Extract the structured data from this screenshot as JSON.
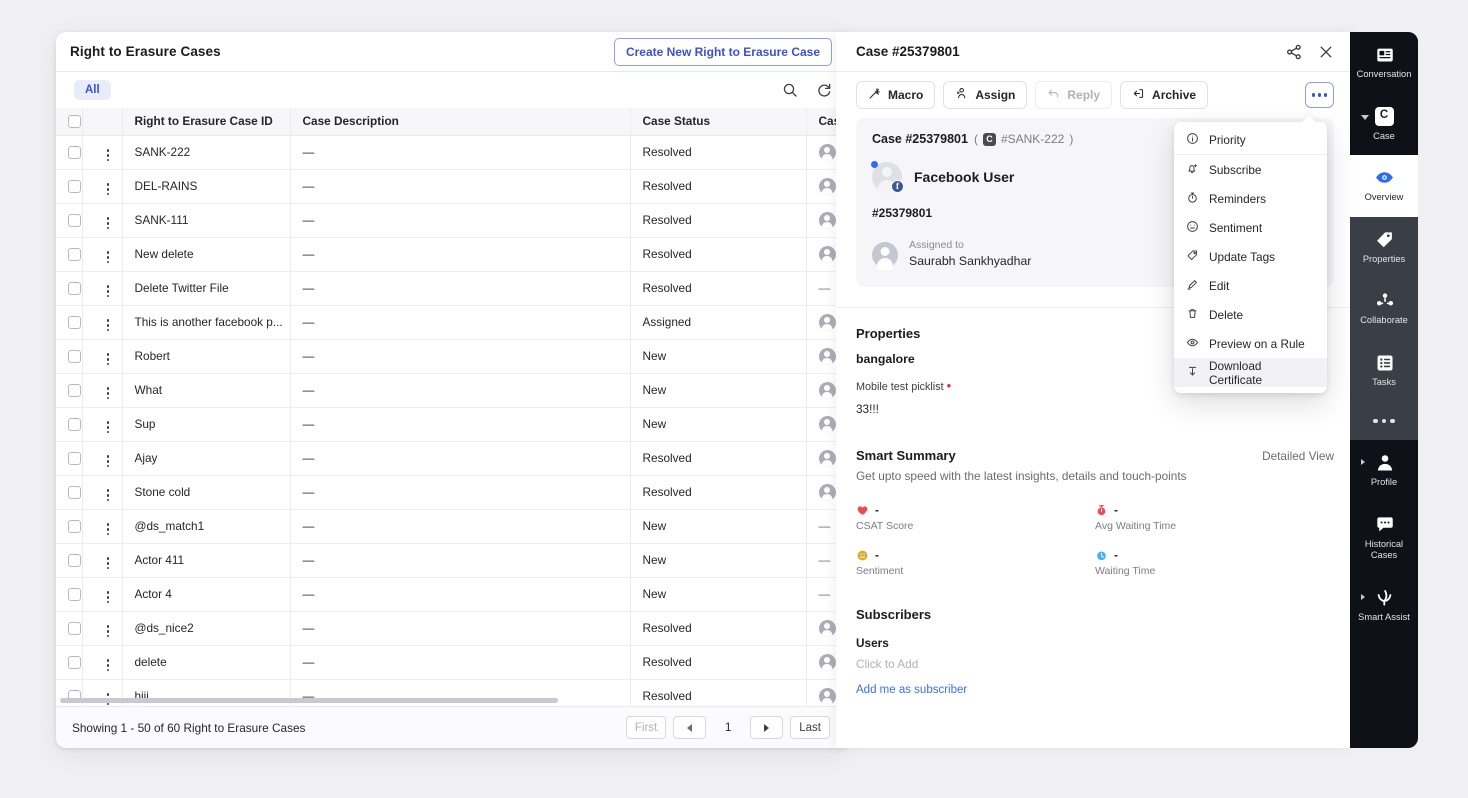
{
  "list": {
    "title": "Right to Erasure Cases",
    "create_button": "Create New Right to Erasure Case",
    "filter_chip": "All",
    "search_icon": "search-icon",
    "refresh_icon": "refresh-icon",
    "columns": [
      "Right to Erasure Case ID",
      "Case Description",
      "Case Status",
      "Case O"
    ],
    "rows": [
      {
        "id": "SANK-222",
        "description": "—",
        "status": "Resolved",
        "owner": "avatar"
      },
      {
        "id": "DEL-RAINS",
        "description": "—",
        "status": "Resolved",
        "owner": "avatar"
      },
      {
        "id": "SANK-111",
        "description": "—",
        "status": "Resolved",
        "owner": "avatar"
      },
      {
        "id": "New delete",
        "description": "—",
        "status": "Resolved",
        "owner": "avatar"
      },
      {
        "id": "Delete Twitter File",
        "description": "—",
        "status": "Resolved",
        "owner": "—"
      },
      {
        "id": "This is another facebook p...",
        "description": "—",
        "status": "Assigned",
        "owner": "avatar"
      },
      {
        "id": "Robert",
        "description": "—",
        "status": "New",
        "owner": "avatar"
      },
      {
        "id": "What",
        "description": "—",
        "status": "New",
        "owner": "avatar"
      },
      {
        "id": "Sup",
        "description": "—",
        "status": "New",
        "owner": "avatar"
      },
      {
        "id": "Ajay",
        "description": "—",
        "status": "Resolved",
        "owner": "avatar"
      },
      {
        "id": "Stone cold",
        "description": "—",
        "status": "Resolved",
        "owner": "avatar"
      },
      {
        "id": "@ds_match1",
        "description": "—",
        "status": "New",
        "owner": "—"
      },
      {
        "id": "Actor 411",
        "description": "—",
        "status": "New",
        "owner": "—"
      },
      {
        "id": "Actor 4",
        "description": "—",
        "status": "New",
        "owner": "—"
      },
      {
        "id": "@ds_nice2",
        "description": "—",
        "status": "Resolved",
        "owner": "avatar"
      },
      {
        "id": "delete",
        "description": "—",
        "status": "Resolved",
        "owner": "avatar"
      },
      {
        "id": "hiii",
        "description": "—",
        "status": "Resolved",
        "owner": "avatar"
      }
    ],
    "footer": {
      "showing": "Showing 1 - 50 of 60 Right to Erasure Cases",
      "first": "First",
      "page": "1",
      "last": "Last"
    }
  },
  "detail": {
    "title": "Case #25379801",
    "share_icon": "share-icon",
    "close_icon": "close-icon",
    "toolbar": {
      "macro": "Macro",
      "assign": "Assign",
      "reply": "Reply",
      "archive": "Archive",
      "more": "more-options"
    },
    "card": {
      "case_number": "Case #25379801",
      "case_ref": "#SANK-222",
      "badge_letter": "C",
      "user_name": "Facebook User",
      "user_id": "#25379801",
      "assigned_label": "Assigned to",
      "assigned_name": "Saurabh Sankhyadhar"
    },
    "properties": {
      "title": "Properties",
      "value": "bangalore",
      "field_label": "Mobile test picklist",
      "field_value": "33!!!"
    },
    "smart_summary": {
      "title": "Smart Summary",
      "detailed_view": "Detailed View",
      "subtitle": "Get upto speed with the latest insights, details and touch-points",
      "metrics": [
        {
          "icon": "heart-icon",
          "value": "-",
          "label": "CSAT Score",
          "color": "#ef4a51"
        },
        {
          "icon": "stopwatch-icon",
          "value": "-",
          "label": "Avg Waiting Time",
          "color": "#ef4a51"
        },
        {
          "icon": "neutral-face-icon",
          "value": "-",
          "label": "Sentiment",
          "color": "#e0a92a"
        },
        {
          "icon": "clock-icon",
          "value": "-",
          "label": "Waiting Time",
          "color": "#39b6ef"
        }
      ]
    },
    "subscribers": {
      "title": "Subscribers",
      "users_label": "Users",
      "placeholder": "Click to Add",
      "add_link": "Add me as subscriber"
    }
  },
  "menu": {
    "items": [
      {
        "label": "Priority",
        "icon": "info-circle-icon"
      },
      {
        "label": "Subscribe",
        "icon": "bell-plus-icon"
      },
      {
        "label": "Reminders",
        "icon": "stopwatch-icon"
      },
      {
        "label": "Sentiment",
        "icon": "neutral-face-icon"
      },
      {
        "label": "Update Tags",
        "icon": "tag-icon"
      },
      {
        "label": "Edit",
        "icon": "pencil-icon"
      },
      {
        "label": "Delete",
        "icon": "trash-icon"
      },
      {
        "label": "Preview on a Rule",
        "icon": "eye-icon"
      },
      {
        "label": "Download Certificate",
        "icon": "download-icon"
      }
    ]
  },
  "rail": {
    "items": [
      {
        "label": "Conversation",
        "icon": "conversation-icon",
        "active": false,
        "group": "dark",
        "caret": "none"
      },
      {
        "label": "Case",
        "icon": "case-c-icon",
        "active": false,
        "group": "dark",
        "caret": "down"
      },
      {
        "label": "Overview",
        "icon": "eye-icon",
        "active": true,
        "group": "light",
        "caret": "none"
      },
      {
        "label": "Properties",
        "icon": "tag-icon",
        "active": false,
        "group": "gray",
        "caret": "none"
      },
      {
        "label": "Collaborate",
        "icon": "collaborate-icon",
        "active": false,
        "group": "gray",
        "caret": "none"
      },
      {
        "label": "Tasks",
        "icon": "tasks-icon",
        "active": false,
        "group": "gray",
        "caret": "none"
      },
      {
        "label": "Profile",
        "icon": "person-icon",
        "active": false,
        "group": "dark",
        "caret": "right"
      },
      {
        "label": "Historical Cases",
        "icon": "chat-bubble-icon",
        "active": false,
        "group": "dark",
        "caret": "none"
      },
      {
        "label": "Smart Assist",
        "icon": "sparkle-icon",
        "active": false,
        "group": "dark",
        "caret": "right"
      }
    ],
    "overflow_dots": "more-rail-items"
  },
  "colors": {
    "accent": "#3a51d6",
    "link": "#3a6ff0",
    "rail_dark": "#0e1117",
    "rail_gray": "#3a3f47"
  }
}
